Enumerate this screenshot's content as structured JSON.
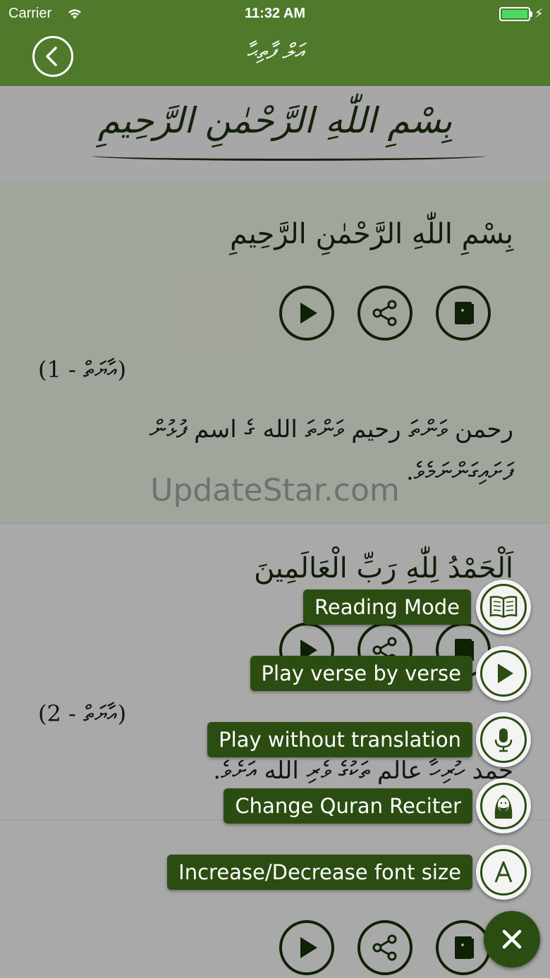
{
  "status_bar": {
    "carrier": "Carrier",
    "time": "11:32 AM",
    "battery_level": 1.0
  },
  "nav": {
    "title": "އަލް ފާތިޙާ",
    "back_icon": "chevron-left-icon"
  },
  "header": {
    "bismillah": "بِسْمِ اللّٰهِ الرَّحْمٰنِ الرَّحِيمِ"
  },
  "verses": [
    {
      "arabic": "بِسْمِ اللّٰهِ الرَّحْمٰنِ الرَّحِيمِ",
      "label": "(އާޔަތް - 1)",
      "translation": "رحمن ވަންތަ رحيم ވަންތަ الله ގެ اسم ފުޅުން ފަށައިގަންނަމެވެ."
    },
    {
      "arabic": "اَلْحَمْدُ لِلّٰهِ رَبِّ الْعَالَمِينَ",
      "label": "(އާޔަތް - 2)",
      "translation": "حمد ހުރިހާ عالم ތަކުގެ ވެރި الله އަށެވެ."
    }
  ],
  "verse_buttons": {
    "play_icon": "play-icon",
    "share_icon": "share-icon",
    "bookmark_icon": "bookmark-icon"
  },
  "watermark": "UpdateStar.com",
  "fab_menu": [
    {
      "label": "Reading Mode",
      "icon": "open-book-icon"
    },
    {
      "label": "Play verse by verse",
      "icon": "play-icon"
    },
    {
      "label": "Play without translation",
      "icon": "microphone-icon"
    },
    {
      "label": "Change Quran Reciter",
      "icon": "reciter-icon"
    },
    {
      "label": "Increase/Decrease font size",
      "icon": "letter-a-icon"
    }
  ],
  "close_fab": {
    "icon": "close-icon"
  },
  "colors": {
    "nav": "#4f7a2b",
    "fab_label": "#2c4d12",
    "icon_dark": "#142b06"
  }
}
